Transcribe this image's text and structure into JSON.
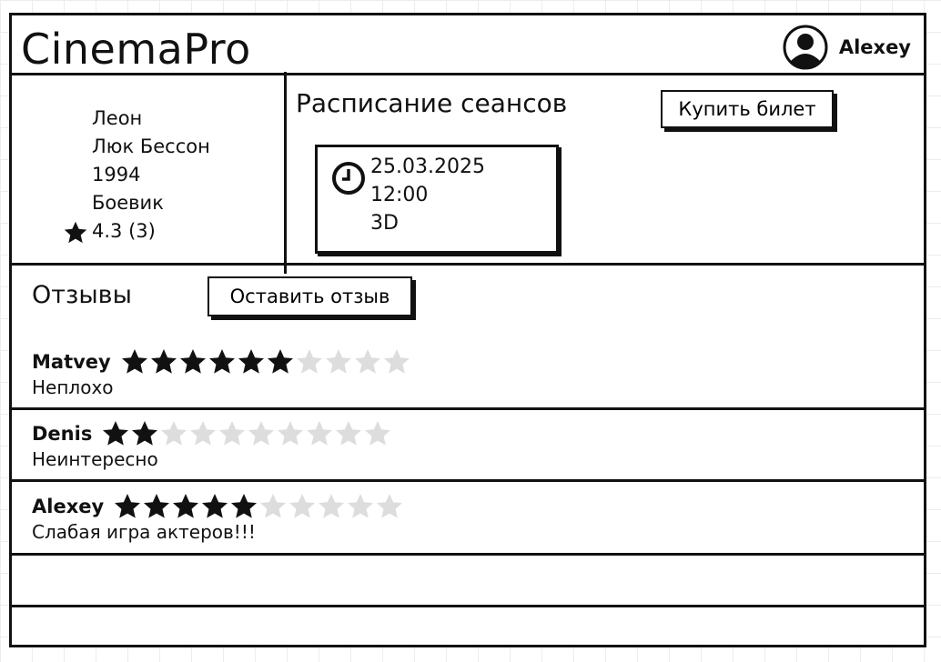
{
  "header": {
    "logo": "CinemaPro",
    "user_name": "Alexey",
    "avatar_icon": "user-avatar-icon"
  },
  "movie": {
    "title": "Леон",
    "director": "Люк Бессон",
    "year": "1994",
    "genre": "Боевик",
    "rating_text": "4.3 (3)",
    "rating_icon": "star-icon"
  },
  "schedule": {
    "title": "Расписание сеансов",
    "buy_label": "Купить билет",
    "sessions": [
      {
        "date": "25.03.2025",
        "time": "12:00",
        "format": "3D",
        "icon": "clock-icon"
      }
    ]
  },
  "reviews": {
    "title": "Отзывы",
    "leave_review_label": "Оставить отзыв",
    "max_stars": 10,
    "items": [
      {
        "author": "Matvey",
        "text": "Неплохо",
        "stars": 6
      },
      {
        "author": "Denis",
        "text": "Неинтересно",
        "stars": 2
      },
      {
        "author": "Alexey",
        "text": "Слабая игра актеров!!!",
        "stars": 5
      }
    ]
  },
  "colors": {
    "ink": "#111111",
    "star_filled": "#111111",
    "star_empty": "#dddddd",
    "grid": "#ececec"
  }
}
